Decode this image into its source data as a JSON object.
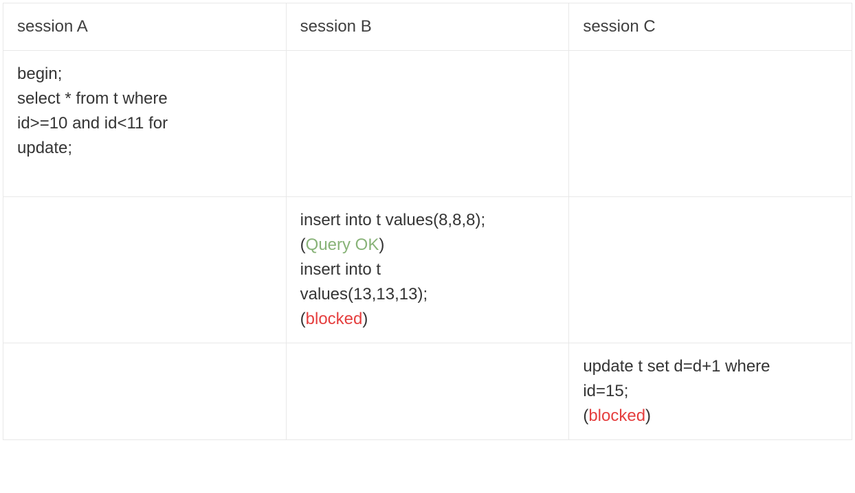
{
  "table": {
    "headers": [
      "session A",
      "session B",
      "session C"
    ],
    "rows": [
      {
        "a": [
          {
            "text": "begin;"
          },
          {
            "text": "select * from t where"
          },
          {
            "text": "id>=10 and id<11 for"
          },
          {
            "text": "update;"
          }
        ],
        "b": [],
        "c": []
      },
      {
        "a": [],
        "b": [
          {
            "text": "insert into t values(8,8,8);"
          },
          {
            "status": "Query OK",
            "statusClass": "status-ok"
          },
          {
            "text": "insert into t"
          },
          {
            "text": "values(13,13,13);"
          },
          {
            "status": "blocked",
            "statusClass": "status-blocked"
          }
        ],
        "c": []
      },
      {
        "a": [],
        "b": [],
        "c": [
          {
            "text": "update t set d=d+1 where"
          },
          {
            "text": "id=15;"
          },
          {
            "status": "blocked",
            "statusClass": "status-blocked"
          }
        ]
      }
    ]
  }
}
